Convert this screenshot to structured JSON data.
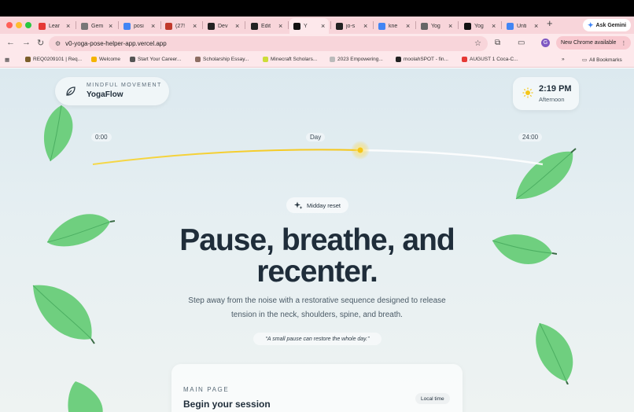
{
  "browser": {
    "tabs": [
      {
        "label": "Lear",
        "color": "#e53935"
      },
      {
        "label": "Gem",
        "color": "#777777"
      },
      {
        "label": "posi",
        "color": "#4285f4"
      },
      {
        "label": "(27!",
        "color": "#c0392b"
      },
      {
        "label": "Dev",
        "color": "#222222"
      },
      {
        "label": "Edit",
        "color": "#222222"
      },
      {
        "label": "Y",
        "color": "#111111"
      },
      {
        "label": "jo-s",
        "color": "#222222"
      },
      {
        "label": "kne",
        "color": "#4285f4"
      },
      {
        "label": "Yog",
        "color": "#666666"
      },
      {
        "label": "Yog",
        "color": "#111111"
      },
      {
        "label": "Unti",
        "color": "#4285f4"
      }
    ],
    "ask_gemini": "Ask Gemini",
    "url": "v0-yoga-pose-helper-app.vercel.app",
    "profile_initial": "G",
    "update_label": "New Chrome available",
    "bookmarks": [
      {
        "label": "REQ0209101 | Req...",
        "color": "#7b5e2a"
      },
      {
        "label": "Welcome",
        "color": "#f4b400"
      },
      {
        "label": "Start Your Career...",
        "color": "#555555"
      },
      {
        "label": "Scholarship Essay...",
        "color": "#8d6e63"
      },
      {
        "label": "Minecraft Scholars...",
        "color": "#cddc39"
      },
      {
        "label": "2023 Empowering...",
        "color": "#bbbbbb"
      },
      {
        "label": "moolahSPOT - fin...",
        "color": "#222222"
      },
      {
        "label": "AUGUST 1 Coca-C...",
        "color": "#e53935"
      }
    ],
    "all_bookmarks": "All Bookmarks"
  },
  "app": {
    "brand_tag": "MINDFUL MOVEMENT",
    "brand_name": "YogaFlow",
    "time": "2:19 PM",
    "period": "Afternoon",
    "timeline": {
      "start": "0:00",
      "mid": "Day",
      "end": "24:00"
    },
    "badge": "Midday reset",
    "headline_line1": "Pause, breathe, and",
    "headline_line2": "recenter.",
    "subtitle_line1": "Step away from the noise with a restorative sequence designed to release",
    "subtitle_line2": "tension in the neck, shoulders, spine, and breath.",
    "quote": "“A small pause can restore the whole day.”",
    "card_eyebrow": "MAIN PAGE",
    "card_title": "Begin your session",
    "card_badge": "Local time"
  },
  "colors": {
    "accent_sun": "#f5c518",
    "leaf": "#6fcf7f",
    "text_dark": "#1f2d3a"
  }
}
